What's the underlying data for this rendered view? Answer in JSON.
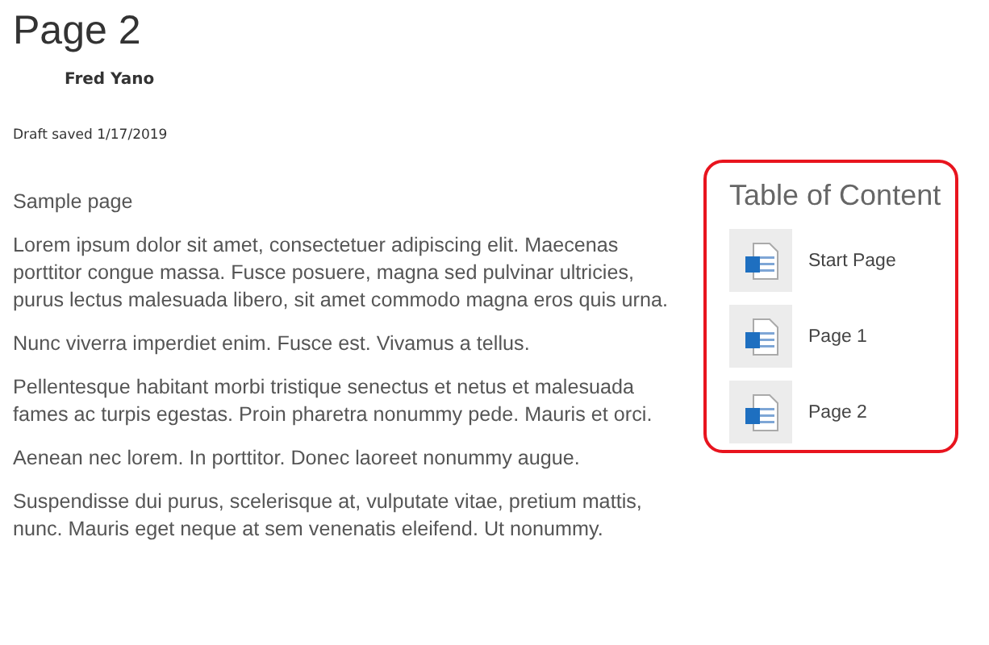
{
  "page": {
    "title": "Page 2",
    "author": "Fred Yano",
    "status": "Draft saved 1/17/2019"
  },
  "content": {
    "heading": "Sample page",
    "paragraphs": [
      "Lorem ipsum dolor sit amet, consectetuer adipiscing elit. Maecenas porttitor congue massa. Fusce posuere, magna sed pulvinar ultricies, purus lectus malesuada libero, sit amet commodo magna eros quis urna.",
      "Nunc viverra imperdiet enim. Fusce est. Vivamus a tellus.",
      "Pellentesque habitant morbi tristique senectus et netus et malesuada fames ac turpis egestas. Proin pharetra nonummy pede. Mauris et orci.",
      "Aenean nec lorem. In porttitor. Donec laoreet nonummy augue.",
      "Suspendisse dui purus, scelerisque at, vulputate vitae, pretium mattis, nunc. Mauris eget neque at sem venenatis eleifend. Ut nonummy."
    ]
  },
  "toc": {
    "title": "Table of Content",
    "items": [
      {
        "label": "Start Page"
      },
      {
        "label": "Page 1"
      },
      {
        "label": "Page 2"
      }
    ]
  }
}
